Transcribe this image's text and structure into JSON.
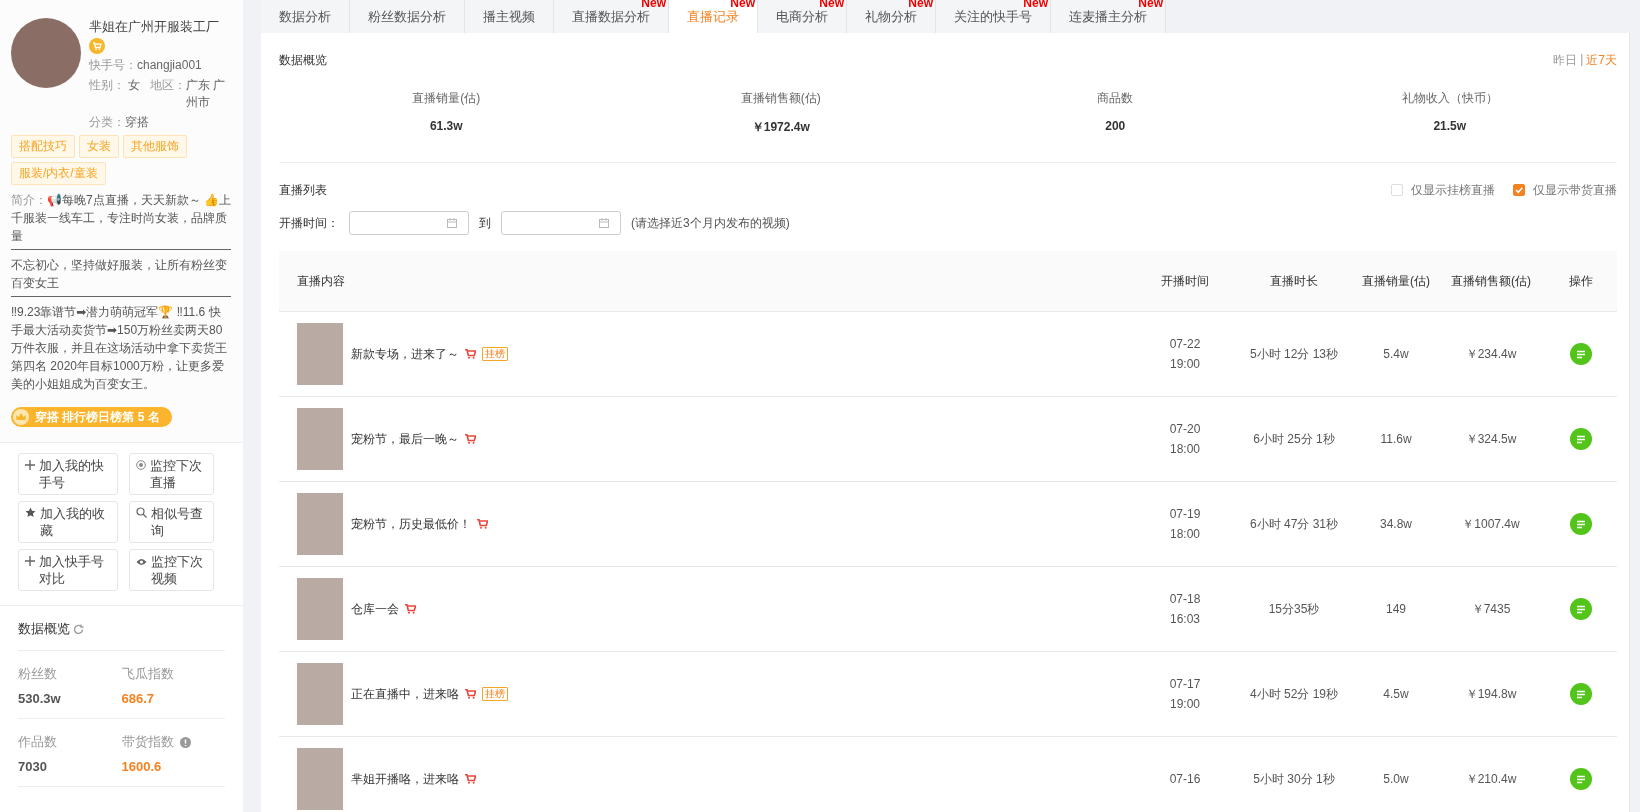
{
  "profile": {
    "name": "芈姐在广州开服装工厂",
    "shop": true,
    "id_label": "快手号：",
    "id": "changjia001",
    "gender_label": "性别：",
    "gender": "女",
    "region_label": "地区：",
    "region": "广东 广州市",
    "category_label": "分类：",
    "category": "穿搭",
    "tags": [
      "搭配技巧",
      "女装",
      "其他服饰",
      "服装/内衣/童装"
    ],
    "intro_label": "简介：",
    "intro": [
      "📢每晚7点直播，天天新款～ 👍上千服装一线车工，专注时尚女装，品牌质量",
      "不忘初心，坚持做好服装，让所有粉丝变百变女王",
      "‼9.23靠谱节➡潜力萌萌冠军🏆 ‼11.6 快手最大活动卖货节➡150万粉丝卖两天80万件衣服，并且在这场活动中拿下卖货王第四名 2020年目标1000万粉，让更多爱美的小姐姐成为百变女王。"
    ],
    "rank": "穿搭 排行榜日榜第 5 名"
  },
  "actions": [
    {
      "label": "加入我的快手号",
      "kind": "plus"
    },
    {
      "label": "监控下次直播",
      "kind": "target"
    },
    {
      "label": "加入我的收藏",
      "kind": "star"
    },
    {
      "label": "相似号查询",
      "kind": "search"
    },
    {
      "label": "加入快手号对比",
      "kind": "plus"
    },
    {
      "label": "监控下次视频",
      "kind": "eye"
    }
  ],
  "sidebar_overview": {
    "title": "数据概览",
    "metrics": [
      {
        "label": "粉丝数",
        "value": "530.3w",
        "highlight": false,
        "info": false
      },
      {
        "label": "飞瓜指数",
        "value": "686.7",
        "highlight": true,
        "info": false
      },
      {
        "label": "作品数",
        "value": "7030",
        "highlight": false,
        "info": false
      },
      {
        "label": "带货指数",
        "value": "1600.6",
        "highlight": true,
        "info": true
      }
    ]
  },
  "tabs": [
    {
      "label": "数据分析",
      "selected": false
    },
    {
      "label": "粉丝数据分析",
      "selected": false
    },
    {
      "label": "播主视频",
      "selected": false
    },
    {
      "label": "直播数据分析",
      "selected": false,
      "badge": "New"
    },
    {
      "label": "直播记录",
      "selected": true,
      "badge": "New"
    },
    {
      "label": "电商分析",
      "selected": false,
      "badge": "New"
    },
    {
      "label": "礼物分析",
      "selected": false,
      "badge": "New"
    },
    {
      "label": "关注的快手号",
      "selected": false,
      "badge": "New"
    },
    {
      "label": "连麦播主分析",
      "selected": false,
      "badge": "New"
    }
  ],
  "overview": {
    "title": "数据概览",
    "ranges": [
      {
        "label": "昨日",
        "selected": false
      },
      {
        "label": "近7天",
        "selected": true
      }
    ],
    "separator": "|",
    "stats": [
      {
        "label": "直播销量(估)",
        "value": "61.3w"
      },
      {
        "label": "直播销售额(估)",
        "value": "￥1972.4w"
      },
      {
        "label": "商品数",
        "value": "200"
      },
      {
        "label": "礼物收入（快币）",
        "value": "21.5w"
      }
    ]
  },
  "live_list": {
    "title": "直播列表",
    "filters": [
      {
        "label": "仅显示挂榜直播",
        "checked": false
      },
      {
        "label": "仅显示带货直播",
        "checked": true
      }
    ],
    "date_label": "开播时间：",
    "to": "到",
    "hint": "(请选择近3个月内发布的视频)"
  },
  "table": {
    "columns": [
      "直播内容",
      "开播时间",
      "直播时长",
      "直播销量(估)",
      "直播销售额(估)",
      "操作"
    ],
    "rows": [
      {
        "title": "新款专场，进来了～",
        "cart": true,
        "tag": "挂榜",
        "date": "07-22",
        "time": "19:00",
        "duration": "5小时 12分 13秒",
        "sales": "5.4w",
        "amount": "￥234.4w"
      },
      {
        "title": "宠粉节，最后一晚～",
        "cart": true,
        "date": "07-20",
        "time": "18:00",
        "duration": "6小时 25分 1秒",
        "sales": "11.6w",
        "amount": "￥324.5w"
      },
      {
        "title": "宠粉节，历史最低价！",
        "cart": true,
        "date": "07-19",
        "time": "18:00",
        "duration": "6小时 47分 31秒",
        "sales": "34.8w",
        "amount": "￥1007.4w"
      },
      {
        "title": "仓库一会",
        "cart": true,
        "date": "07-18",
        "time": "16:03",
        "duration": "15分35秒",
        "sales": "149",
        "amount": "￥7435"
      },
      {
        "title": "正在直播中，进来咯",
        "cart": true,
        "tag": "挂榜",
        "date": "07-17",
        "time": "19:00",
        "duration": "4小时 52分 19秒",
        "sales": "4.5w",
        "amount": "￥194.8w"
      },
      {
        "title": "芈姐开播咯，进来咯",
        "cart": true,
        "date": "07-16",
        "duration": "5小时 30分 1秒",
        "sales": "5.0w",
        "amount": "￥210.4w"
      }
    ]
  }
}
